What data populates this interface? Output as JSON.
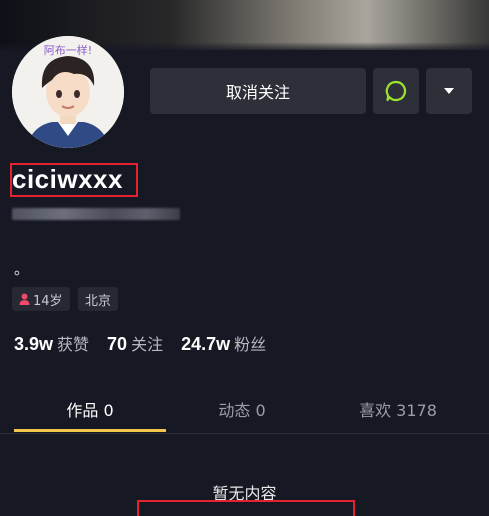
{
  "profile": {
    "username": "ciciwxxx",
    "bio": "。",
    "age_tag": "14岁",
    "location_tag": "北京"
  },
  "actions": {
    "unfollow_label": "取消关注",
    "message_icon": "chat-bubble-icon",
    "more_icon": "caret-down-icon"
  },
  "stats": [
    {
      "value": "3.9w",
      "label": "获赞"
    },
    {
      "value": "70",
      "label": "关注"
    },
    {
      "value": "24.7w",
      "label": "粉丝"
    }
  ],
  "tabs": [
    {
      "label": "作品 0",
      "active": true
    },
    {
      "label": "动态 0",
      "active": false
    },
    {
      "label": "喜欢 3178",
      "active": false
    }
  ],
  "empty_state": "暂无内容",
  "colors": {
    "background": "#161823",
    "button": "#2d2f39",
    "tab_indicator": "#f1c64a",
    "highlight_box": "#e52330",
    "message_icon": "#9be32f",
    "age_icon": "#f04a6a"
  }
}
